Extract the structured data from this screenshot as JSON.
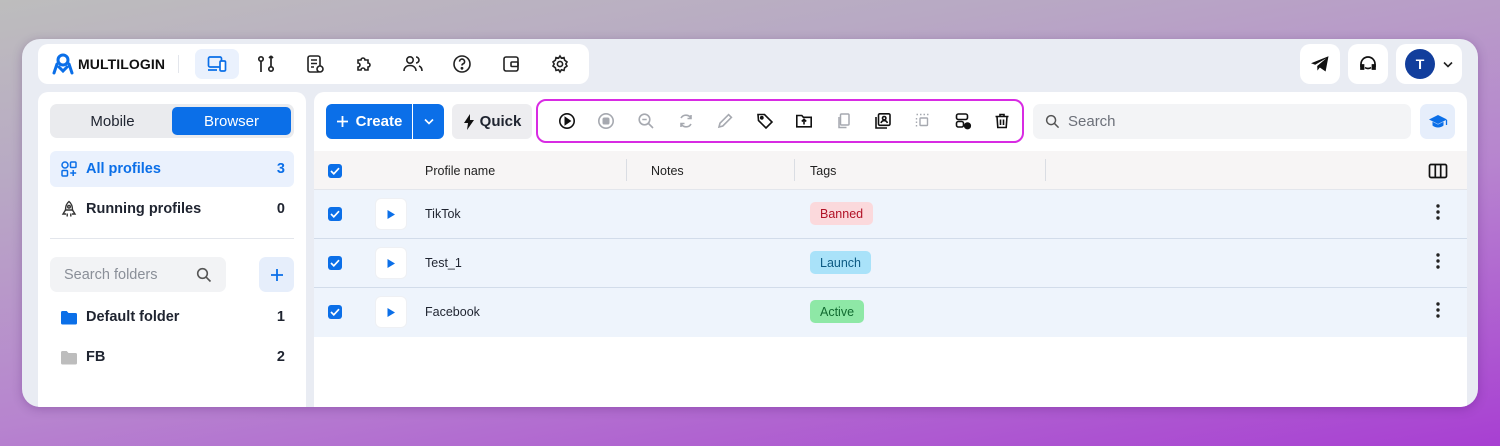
{
  "app": {
    "brand": "MULTILOGIN"
  },
  "nav": {
    "icons": [
      "browser-profiles-icon",
      "automation-icon",
      "proxy-list-icon",
      "extensions-icon",
      "team-icon",
      "help-icon",
      "wallet-icon",
      "settings-icon"
    ],
    "active": "browser-profiles-icon"
  },
  "topbar": {
    "avatar_initial": "T"
  },
  "sidebar": {
    "mode_tabs": [
      "Mobile",
      "Browser"
    ],
    "active_mode": "Browser",
    "filters": [
      {
        "label": "All profiles",
        "count": "3"
      },
      {
        "label": "Running profiles",
        "count": "0"
      }
    ],
    "search_placeholder": "Search folders",
    "folders": [
      {
        "name": "Default folder",
        "count": "1",
        "color": "#0b6fe8"
      },
      {
        "name": "FB",
        "count": "2",
        "color": "#bdbdbd"
      }
    ]
  },
  "toolbar": {
    "create_label": "Create",
    "quick_label": "Quick",
    "actions": [
      "start-icon",
      "stop-icon",
      "check-proxy-icon",
      "sync-icon",
      "edit-icon",
      "tag-icon",
      "move-to-folder-icon",
      "clone-icon",
      "cookie-import-icon",
      "select-icon",
      "export-icon",
      "delete-icon"
    ],
    "search_placeholder": "Search"
  },
  "table": {
    "columns": [
      "Profile name",
      "Notes",
      "Tags"
    ],
    "rows": [
      {
        "name": "TikTok",
        "notes": "",
        "tag": "Banned",
        "tag_bg": "#fbd9dc",
        "tag_fg": "#b11226"
      },
      {
        "name": "Test_1",
        "notes": "",
        "tag": "Launch",
        "tag_bg": "#a9e2f9",
        "tag_fg": "#0c5a83"
      },
      {
        "name": "Facebook",
        "notes": "",
        "tag": "Active",
        "tag_bg": "#8ee8a6",
        "tag_fg": "#116b30"
      }
    ]
  },
  "colors": {
    "accent": "#0b6fe8",
    "highlight_border": "#d82be3"
  }
}
